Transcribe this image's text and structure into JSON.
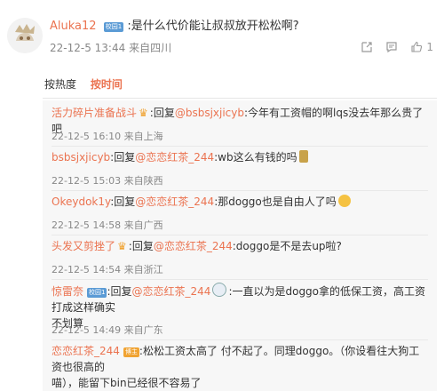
{
  "post": {
    "username": "Aluka12",
    "badge": "校园1",
    "text": ":是什么代价能让叔叔放开松松啊?",
    "time": "22-12-5 13:44",
    "source": "来自四川",
    "like_count": "1"
  },
  "tabs": [
    {
      "label": "按热度",
      "active": false
    },
    {
      "label": "按时间",
      "active": true
    }
  ],
  "replies": [
    {
      "username": "活力碎片准备战斗",
      "text_before": ":回复",
      "mention": "@bsbsjxjicyb",
      "text_after": ":今年有工资帽的啊lqs没去年那么贵了吧",
      "time": "22-12-5 16:10",
      "source": "来自上海"
    },
    {
      "username": "bsbsjxjicyb",
      "text_before": ":回复",
      "mention": "@恋恋红茶_244",
      "text_after": ":wb这么有钱的吗",
      "time": "22-12-5 15:03",
      "source": "来自陕西"
    },
    {
      "username": "Okeydok1y",
      "text_before": ":回复",
      "mention": "@恋恋红茶_244",
      "text_after": ":那doggo也是自由人了吗",
      "time": "22-12-5 14:58",
      "source": "来自广西"
    },
    {
      "username": "头发又剪挫了",
      "text_before": ":回复",
      "mention": "@恋恋红茶_244",
      "text_after": ":doggo是不是去up啦?",
      "time": "22-12-5 14:54",
      "source": "来自浙江"
    },
    {
      "username": "惊雷奈",
      "badge": "校园1",
      "text_before": ":回复",
      "mention": "@恋恋红茶_244",
      "text_after_line1": ":一直以为是doggo拿的低保工资，高工资打成这样确实",
      "text_after_line2": "不划算",
      "time": "22-12-5 14:49",
      "source": "来自广东"
    },
    {
      "username": "恋恋红茶_244",
      "badge": "博主",
      "text_line1": ":松松工资太高了 付不起了。同理doggo。（你设看往大狗工资也很高的",
      "text_line2": "喵），能留下bin已经很不容易了"
    }
  ],
  "colors": {
    "accent": "#eb7350",
    "meta": "#888888",
    "badge_blue": "#5b9bd5",
    "badge_orange": "#f0a332",
    "reply_bg": "#f7f7f7"
  },
  "icons": [
    "user-avatar",
    "share-icon",
    "comment-icon",
    "like-icon",
    "crown-icon",
    "emoji-icon"
  ]
}
